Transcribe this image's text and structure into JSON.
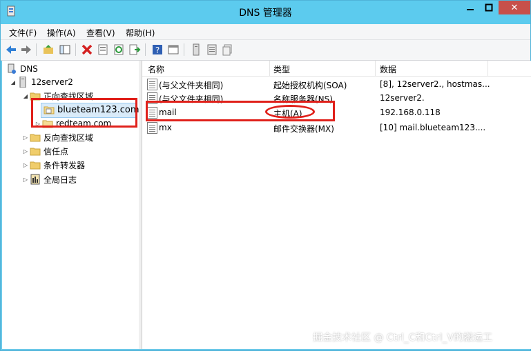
{
  "window": {
    "title": "DNS 管理器",
    "close_glyph": "✕"
  },
  "menu": [
    "文件(F)",
    "操作(A)",
    "查看(V)",
    "帮助(H)"
  ],
  "tree": {
    "root": "DNS",
    "server": "12server2",
    "forward_zone": "正向查找区域",
    "zones": [
      "blueteam123.com",
      "redteam.com"
    ],
    "reverse_zone": "反向查找区域",
    "trust_points": "信任点",
    "conditional_forwarders": "条件转发器",
    "global_logs": "全局日志"
  },
  "table": {
    "columns": [
      "名称",
      "类型",
      "数据"
    ],
    "rows": [
      {
        "name": "(与父文件夹相同)",
        "type": "起始授权机构(SOA)",
        "data": "[8], 12server2., hostmas..."
      },
      {
        "name": "(与父文件夹相同)",
        "type": "名称服务器(NS)",
        "data": "12server2."
      },
      {
        "name": "mail",
        "type": "主机(A)",
        "data": "192.168.0.118"
      },
      {
        "name": "mx",
        "type": "邮件交换器(MX)",
        "data": "[10]  mail.blueteam123...."
      }
    ]
  },
  "watermark": "掘金技术社区 @ Ctrl_C和Ctrl_V的搬运工",
  "colors": {
    "titlebar": "#5ccbee",
    "highlight": "#e0201a",
    "selection": "#d9ebf9"
  }
}
